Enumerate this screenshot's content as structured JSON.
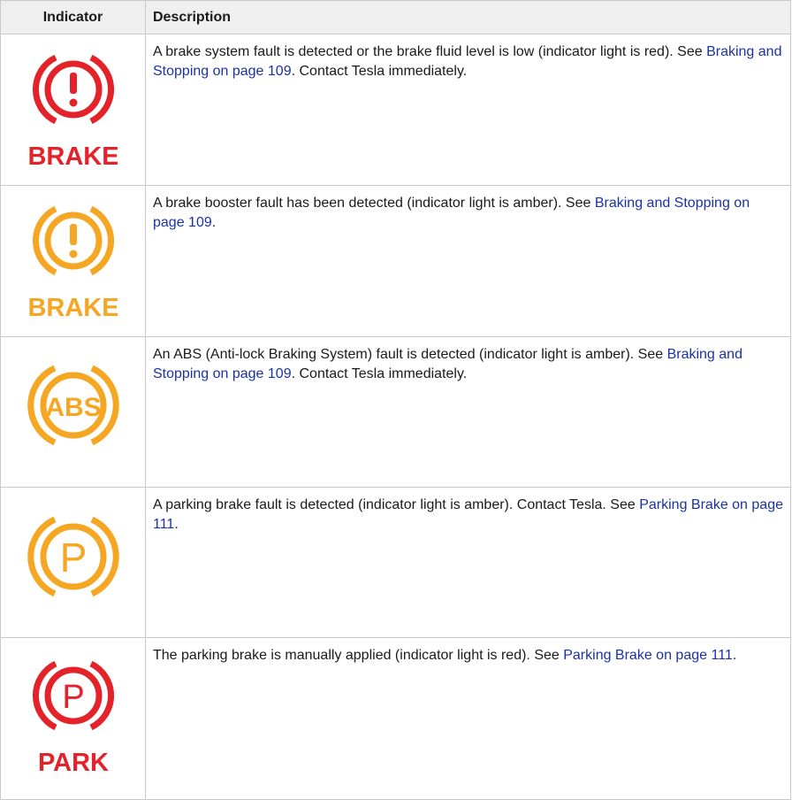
{
  "headers": {
    "indicator": "Indicator",
    "description": "Description"
  },
  "colors": {
    "red": "#e3222a",
    "amber": "#f5a623",
    "link": "#1a32a6"
  },
  "rows": [
    {
      "icon_name": "brake-red-icon",
      "icon_label": "BRAKE",
      "icon_color": "red",
      "desc_a": "A brake system fault is detected or the brake fluid level is low (indicator light is red). See ",
      "link1": "Braking and Stopping on page 109",
      "desc_b": ". Contact Tesla immediately."
    },
    {
      "icon_name": "brake-amber-icon",
      "icon_label": "BRAKE",
      "icon_color": "amber",
      "desc_a": "A brake booster fault has been detected (indicator light is amber). See ",
      "link1": "Braking and Stopping on page 109",
      "desc_b": "."
    },
    {
      "icon_name": "abs-amber-icon",
      "icon_label": "ABS",
      "icon_color": "amber",
      "desc_a": "An ABS (Anti-lock Braking System) fault is detected (indicator light is amber). See ",
      "link1": "Braking and Stopping on page 109",
      "desc_b": ". Contact Tesla immediately."
    },
    {
      "icon_name": "parking-brake-fault-amber-icon",
      "icon_label": "P",
      "icon_color": "amber",
      "desc_a": "A parking brake fault is detected (indicator light is amber). Contact Tesla. See ",
      "link1": "Parking Brake on page 111",
      "desc_b": "."
    },
    {
      "icon_name": "park-red-icon",
      "icon_label": "P",
      "icon_sublabel": "PARK",
      "icon_color": "red",
      "desc_a": "The parking brake is manually applied (indicator light is red). See ",
      "link1": "Parking Brake on page 111",
      "desc_b": "."
    }
  ]
}
